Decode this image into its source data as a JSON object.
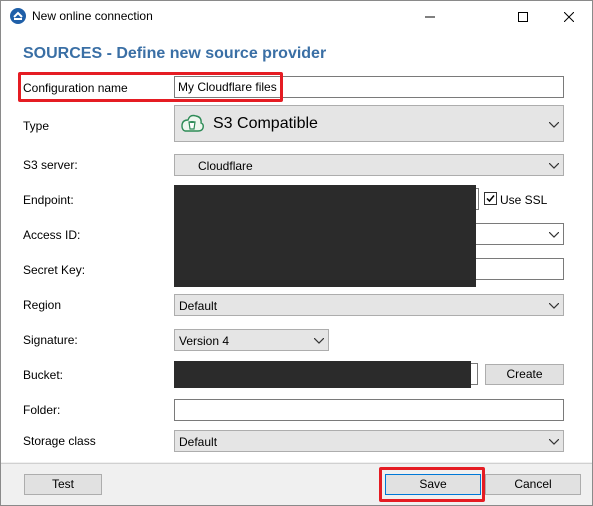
{
  "window": {
    "title": "New online connection",
    "controls": [
      "minimize",
      "maximize",
      "close"
    ]
  },
  "heading": "SOURCES - Define new source provider",
  "form": {
    "configuration_name": {
      "label": "Configuration name",
      "value": "My Cloudflare files"
    },
    "type": {
      "label": "Type",
      "value": "S3 Compatible"
    },
    "s3_server": {
      "label": "S3 server:",
      "value": "Cloudflare"
    },
    "endpoint": {
      "label": "Endpoint:",
      "use_ssl_label": "Use SSL",
      "use_ssl_checked": true
    },
    "access_id": {
      "label": "Access ID:"
    },
    "secret_key": {
      "label": "Secret Key:"
    },
    "region": {
      "label": "Region",
      "value": "Default"
    },
    "signature": {
      "label": "Signature:",
      "value": "Version 4"
    },
    "bucket": {
      "label": "Bucket:",
      "create_label": "Create"
    },
    "folder": {
      "label": "Folder:",
      "value": ""
    },
    "storage_class": {
      "label": "Storage class",
      "value": "Default"
    }
  },
  "footer": {
    "test_label": "Test",
    "save_label": "Save",
    "cancel_label": "Cancel"
  },
  "colors": {
    "heading": "#3a6fa5",
    "highlight": "#e51c23",
    "redaction": "#2b2b2b"
  }
}
